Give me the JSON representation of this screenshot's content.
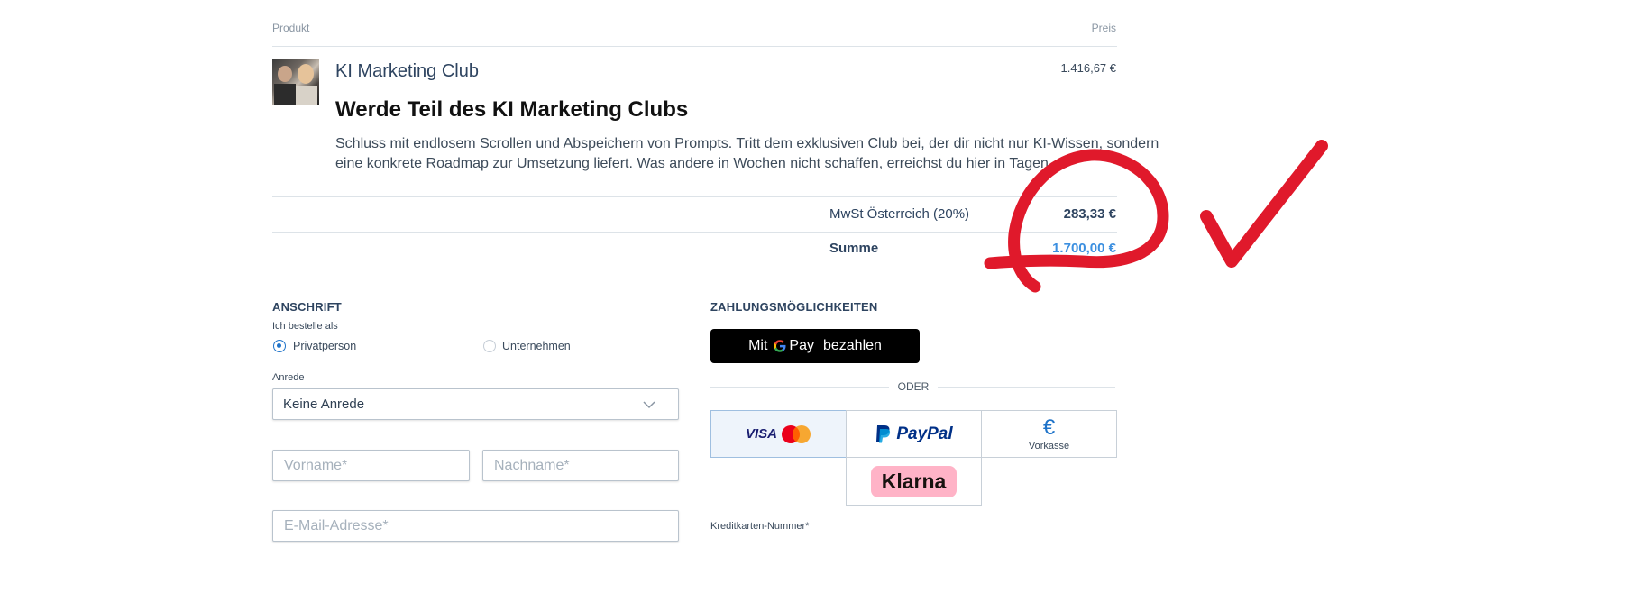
{
  "table_header": {
    "product": "Produkt",
    "price": "Preis"
  },
  "product": {
    "name": "KI Marketing Club",
    "headline": "Werde Teil des KI Marketing Clubs",
    "description": "Schluss mit endlosem Scrollen und Abspeichern von Prompts. Tritt dem exklusiven Club bei, der dir nicht nur KI-Wissen, sondern eine konkrete Roadmap zur Umsetzung liefert. Was andere in Wochen nicht schaffen, erreichst du hier in Tagen.",
    "price": "1.416,67 €"
  },
  "totals": {
    "tax_label": "MwSt Österreich (20%)",
    "tax_value": "283,33 €",
    "sum_label": "Summe",
    "sum_value": "1.700,00 €"
  },
  "address": {
    "title": "ANSCHRIFT",
    "order_as_label": "Ich bestelle als",
    "options": [
      "Privatperson",
      "Unternehmen"
    ],
    "selected_option": "Privatperson",
    "salutation_label": "Anrede",
    "salutation_value": "Keine Anrede",
    "firstname_placeholder": "Vorname*",
    "lastname_placeholder": "Nachname*",
    "email_placeholder": "E-Mail-Adresse*"
  },
  "payment": {
    "title": "ZAHLUNGSMÖGLICHKEITEN",
    "gpay_prefix": "Mit",
    "gpay_brand": "Pay",
    "gpay_suffix": "bezahlen",
    "or_label": "ODER",
    "visa_label": "VISA",
    "paypal_label": "PayPal",
    "vorkasse_label": "Vorkasse",
    "klarna_label": "Klarna",
    "card_number_label": "Kreditkarten-Nummer*"
  },
  "colors": {
    "accent": "#1e73c9",
    "sum": "#3b8fe0",
    "annotation": "#e0192b",
    "klarna_pink": "#ffb3c7",
    "paypal_dark": "#003087",
    "paypal_light": "#009cde"
  }
}
